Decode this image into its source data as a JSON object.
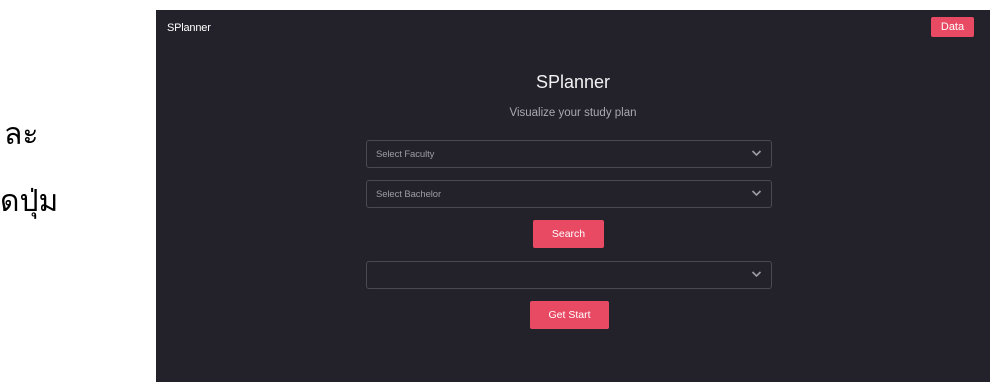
{
  "side_text": {
    "line1": "ละ",
    "line2": "ดปุ่ม"
  },
  "navbar": {
    "brand": "SPlanner",
    "data_button": "Data"
  },
  "hero": {
    "title": "SPlanner",
    "subtitle": "Visualize your study plan"
  },
  "form": {
    "faculty_select": {
      "selected": "Select Faculty",
      "icon": "chevron-down-icon"
    },
    "bachelor_select": {
      "selected": "Select Bachelor",
      "icon": "chevron-down-icon"
    },
    "search_button": "Search",
    "third_select": {
      "selected": "",
      "icon": "chevron-down-icon"
    },
    "start_button": "Get Start"
  },
  "colors": {
    "background": "#23222a",
    "accent": "#e84a64",
    "border": "#4a4953"
  }
}
